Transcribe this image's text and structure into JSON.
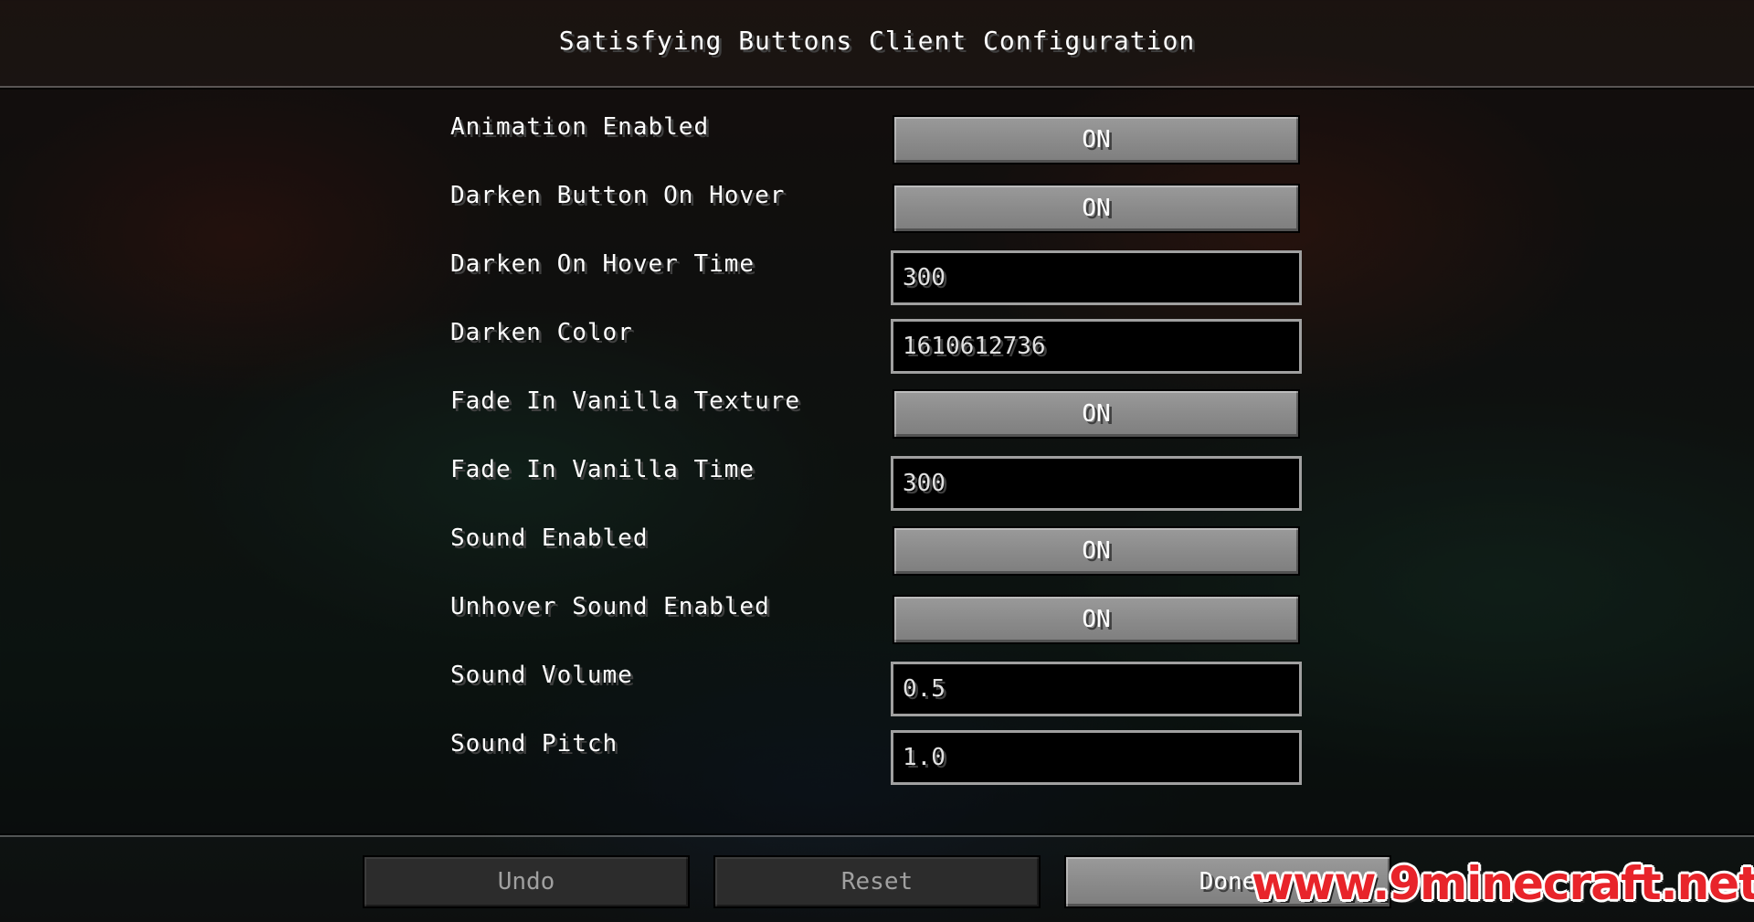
{
  "header": {
    "title": "Satisfying Buttons Client Configuration"
  },
  "settings": [
    {
      "label": "Animation Enabled",
      "type": "toggle",
      "value": "ON"
    },
    {
      "label": "Darken Button On Hover",
      "type": "toggle",
      "value": "ON"
    },
    {
      "label": "Darken On Hover Time",
      "type": "text",
      "value": "300"
    },
    {
      "label": "Darken Color",
      "type": "text",
      "value": "1610612736"
    },
    {
      "label": "Fade In Vanilla Texture",
      "type": "toggle",
      "value": "ON"
    },
    {
      "label": "Fade In Vanilla Time",
      "type": "text",
      "value": "300"
    },
    {
      "label": "Sound Enabled",
      "type": "toggle",
      "value": "ON"
    },
    {
      "label": "Unhover Sound Enabled",
      "type": "toggle",
      "value": "ON"
    },
    {
      "label": "Sound Volume",
      "type": "text",
      "value": "0.5"
    },
    {
      "label": "Sound Pitch",
      "type": "text",
      "value": "1.0"
    }
  ],
  "footer": {
    "undo_label": "Undo",
    "reset_label": "Reset",
    "done_label": "Done"
  },
  "watermark": {
    "text": "www.9minecraft.net"
  }
}
